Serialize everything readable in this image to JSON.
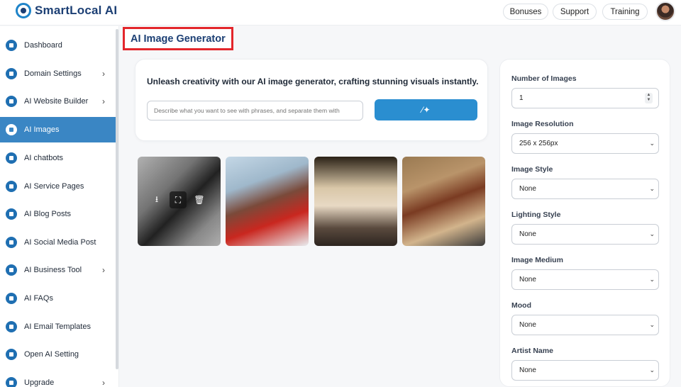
{
  "app": {
    "name": "SmartLocal AI"
  },
  "topbar": {
    "buttons": [
      {
        "label": "Bonuses"
      },
      {
        "label": "Support"
      },
      {
        "label": "Training"
      }
    ]
  },
  "sidebar": {
    "items": [
      {
        "label": "Dashboard",
        "has_submenu": false,
        "active": false,
        "icon": "home-icon"
      },
      {
        "label": "Domain Settings",
        "has_submenu": true,
        "active": false,
        "icon": "domain-icon"
      },
      {
        "label": "AI Website Builder",
        "has_submenu": true,
        "active": false,
        "icon": "builder-icon"
      },
      {
        "label": "AI Images",
        "has_submenu": false,
        "active": true,
        "icon": "image-icon"
      },
      {
        "label": "AI chatbots",
        "has_submenu": false,
        "active": false,
        "icon": "chat-icon"
      },
      {
        "label": "AI Service Pages",
        "has_submenu": false,
        "active": false,
        "icon": "page-icon"
      },
      {
        "label": "AI Blog Posts",
        "has_submenu": false,
        "active": false,
        "icon": "blog-icon"
      },
      {
        "label": "AI Social Media Post",
        "has_submenu": false,
        "active": false,
        "icon": "share-icon"
      },
      {
        "label": "AI Business Tool",
        "has_submenu": true,
        "active": false,
        "icon": "chart-icon"
      },
      {
        "label": "AI FAQs",
        "has_submenu": false,
        "active": false,
        "icon": "faq-icon"
      },
      {
        "label": "AI Email Templates",
        "has_submenu": false,
        "active": false,
        "icon": "email-icon"
      },
      {
        "label": "Open AI Setting",
        "has_submenu": false,
        "active": false,
        "icon": "user-settings-icon"
      },
      {
        "label": "Upgrade",
        "has_submenu": true,
        "active": false,
        "icon": "upgrade-icon"
      }
    ]
  },
  "page": {
    "title": "AI Image Generator"
  },
  "generator": {
    "heading": "Unleash creativity with our AI image generator, crafting stunning visuals instantly.",
    "prompt_placeholder": "Describe what you want to see with phrases, and separate them with",
    "generate_icon": "magic-wand-icon"
  },
  "images": [
    {
      "alt": "generated image 1",
      "tools": [
        "download-icon",
        "expand-icon",
        "trash-icon"
      ]
    },
    {
      "alt": "generated image 2"
    },
    {
      "alt": "generated image 3"
    },
    {
      "alt": "generated image 4"
    }
  ],
  "settings": {
    "number_of_images": {
      "label": "Number of Images",
      "value": "1"
    },
    "image_resolution": {
      "label": "Image Resolution",
      "value": "256 x 256px"
    },
    "image_style": {
      "label": "Image Style",
      "value": "None"
    },
    "lighting_style": {
      "label": "Lighting Style",
      "value": "None"
    },
    "image_medium": {
      "label": "Image Medium",
      "value": "None"
    },
    "mood": {
      "label": "Mood",
      "value": "None"
    },
    "artist_name": {
      "label": "Artist Name",
      "value": "None"
    }
  },
  "colors": {
    "brand": "#1c3f74",
    "accent": "#2a8ed0",
    "active_nav": "#3a86c4",
    "highlight_box": "#e3262b"
  }
}
